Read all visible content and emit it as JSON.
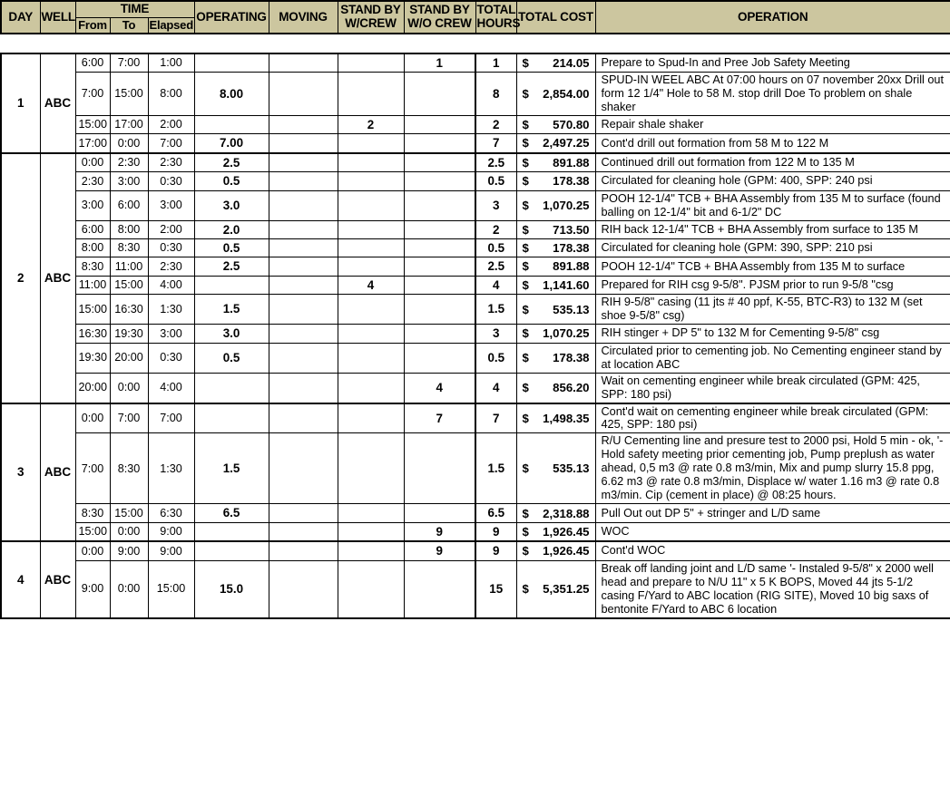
{
  "header": {
    "columns": {
      "day": "DAY",
      "well": "WELL",
      "time": "TIME",
      "from": "From",
      "to": "To",
      "elapsed": "Elapsed",
      "operating": "OPERATING",
      "moving": "MOVING",
      "standby_with_crew": "STAND BY W/CREW",
      "standby_with_crew_l1": "STAND BY",
      "standby_with_crew_l2": "W/CREW",
      "standby_without_crew_l1": "STAND BY",
      "standby_without_crew_l2": "W/O CREW",
      "total_hours_l1": "TOTAL",
      "total_hours_l2": "HOURS",
      "total_cost": "TOTAL COST",
      "operation": "OPERATION"
    }
  },
  "colors": {
    "header_bg": "#ccc69f",
    "grid": "#000000",
    "page_bg": "#ffffff"
  },
  "days": [
    {
      "day": "1",
      "well": "ABC",
      "rows": [
        {
          "from": "6:00",
          "to": "7:00",
          "elapsed": "1:00",
          "operating": "",
          "moving": "",
          "sb_with": "",
          "sb_without": "1",
          "total_hours": "1",
          "currency": "$",
          "cost": "214.05",
          "operation": "Prepare to Spud-In and Pree Job Safety Meeting"
        },
        {
          "from": "7:00",
          "to": "15:00",
          "elapsed": "8:00",
          "operating": "8.00",
          "moving": "",
          "sb_with": "",
          "sb_without": "",
          "total_hours": "8",
          "currency": "$",
          "cost": "2,854.00",
          "operation": "SPUD-IN WEEL ABC At 07:00 hours on 07 november 20xx Drill out form 12 1/4\" Hole to 58 M. stop drill Doe To problem on shale shaker"
        },
        {
          "from": "15:00",
          "to": "17:00",
          "elapsed": "2:00",
          "operating": "",
          "moving": "",
          "sb_with": "2",
          "sb_without": "",
          "total_hours": "2",
          "currency": "$",
          "cost": "570.80",
          "operation": "Repair shale shaker"
        },
        {
          "from": "17:00",
          "to": "0:00",
          "elapsed": "7:00",
          "operating": "7.00",
          "moving": "",
          "sb_with": "",
          "sb_without": "",
          "total_hours": "7",
          "currency": "$",
          "cost": "2,497.25",
          "operation": "Cont'd drill out formation from 58 M to 122 M"
        }
      ]
    },
    {
      "day": "2",
      "well": "ABC",
      "rows": [
        {
          "from": "0:00",
          "to": "2:30",
          "elapsed": "2:30",
          "operating": "2.5",
          "moving": "",
          "sb_with": "",
          "sb_without": "",
          "total_hours": "2.5",
          "currency": "$",
          "cost": "891.88",
          "operation": "Continued drill out formation from 122 M to 135 M"
        },
        {
          "from": "2:30",
          "to": "3:00",
          "elapsed": "0:30",
          "operating": "0.5",
          "moving": "",
          "sb_with": "",
          "sb_without": "",
          "total_hours": "0.5",
          "currency": "$",
          "cost": "178.38",
          "operation": "Circulated for cleaning hole (GPM: 400, SPP: 240 psi"
        },
        {
          "from": "3:00",
          "to": "6:00",
          "elapsed": "3:00",
          "operating": "3.0",
          "moving": "",
          "sb_with": "",
          "sb_without": "",
          "total_hours": "3",
          "currency": "$",
          "cost": "1,070.25",
          "operation": "POOH 12-1/4\" TCB + BHA Assembly from 135 M to surface  (found balling on 12-1/4\" bit and 6-1/2\" DC"
        },
        {
          "from": "6:00",
          "to": "8:00",
          "elapsed": "2:00",
          "operating": "2.0",
          "moving": "",
          "sb_with": "",
          "sb_without": "",
          "total_hours": "2",
          "currency": "$",
          "cost": "713.50",
          "operation": "RIH back 12-1/4\" TCB + BHA Assembly from surface to 135 M"
        },
        {
          "from": "8:00",
          "to": "8:30",
          "elapsed": "0:30",
          "operating": "0.5",
          "moving": "",
          "sb_with": "",
          "sb_without": "",
          "total_hours": "0.5",
          "currency": "$",
          "cost": "178.38",
          "operation": "Circulated for cleaning hole (GPM: 390, SPP: 210 psi"
        },
        {
          "from": "8:30",
          "to": "11:00",
          "elapsed": "2:30",
          "operating": "2.5",
          "moving": "",
          "sb_with": "",
          "sb_without": "",
          "total_hours": "2.5",
          "currency": "$",
          "cost": "891.88",
          "operation": "POOH 12-1/4\" TCB + BHA Assembly from 135 M to surface"
        },
        {
          "from": "11:00",
          "to": "15:00",
          "elapsed": "4:00",
          "operating": "",
          "moving": "",
          "sb_with": "4",
          "sb_without": "",
          "total_hours": "4",
          "currency": "$",
          "cost": "1,141.60",
          "operation": "Prepared for RIH csg 9-5/8\". PJSM prior to run 9-5/8 \"csg"
        },
        {
          "from": "15:00",
          "to": "16:30",
          "elapsed": "1:30",
          "operating": "1.5",
          "moving": "",
          "sb_with": "",
          "sb_without": "",
          "total_hours": "1.5",
          "currency": "$",
          "cost": "535.13",
          "operation": "RIH 9-5/8\" casing (11 jts # 40 ppf, K-55, BTC-R3) to 132 M (set shoe 9-5/8\" csg)"
        },
        {
          "from": "16:30",
          "to": "19:30",
          "elapsed": "3:00",
          "operating": "3.0",
          "moving": "",
          "sb_with": "",
          "sb_without": "",
          "total_hours": "3",
          "currency": "$",
          "cost": "1,070.25",
          "operation": "RIH stinger + DP 5\" to 132 M for Cementing 9-5/8\" csg"
        },
        {
          "from": "19:30",
          "to": "20:00",
          "elapsed": "0:30",
          "operating": "0.5",
          "moving": "",
          "sb_with": "",
          "sb_without": "",
          "total_hours": "0.5",
          "currency": "$",
          "cost": "178.38",
          "operation": "Circulated prior to cementing job. No Cementing engineer stand by at location ABC"
        },
        {
          "from": "20:00",
          "to": "0:00",
          "elapsed": "4:00",
          "operating": "",
          "moving": "",
          "sb_with": "",
          "sb_without": "4",
          "total_hours": "4",
          "currency": "$",
          "cost": "856.20",
          "operation": "Wait on cementing engineer while break circulated (GPM: 425, SPP: 180 psi)"
        }
      ]
    },
    {
      "day": "3",
      "well": "ABC",
      "rows": [
        {
          "from": "0:00",
          "to": "7:00",
          "elapsed": "7:00",
          "operating": "",
          "moving": "",
          "sb_with": "",
          "sb_without": "7",
          "total_hours": "7",
          "currency": "$",
          "cost": "1,498.35",
          "operation": "Cont'd wait on cementing engineer while break circulated (GPM: 425, SPP: 180 psi)"
        },
        {
          "from": "7:00",
          "to": "8:30",
          "elapsed": "1:30",
          "operating": "1.5",
          "moving": "",
          "sb_with": "",
          "sb_without": "",
          "total_hours": "1.5",
          "currency": "$",
          "cost": "535.13",
          "operation": "R/U Cementing line and presure test to 2000 psi, Hold 5 min - ok, '- Hold safety meeting prior cementing job, Pump preplush as water ahead, 0,5 m3 @ rate 0.8 m3/min, Mix and pump slurry 15.8 ppg, 6.62 m3 @ rate 0.8 m3/min, Displace w/ water 1.16 m3 @ rate 0.8 m3/min. Cip (cement in place) @ 08:25 hours."
        },
        {
          "from": "8:30",
          "to": "15:00",
          "elapsed": "6:30",
          "operating": "6.5",
          "moving": "",
          "sb_with": "",
          "sb_without": "",
          "total_hours": "6.5",
          "currency": "$",
          "cost": "2,318.88",
          "operation": "Pull Out out DP 5\" + stringer and L/D same"
        },
        {
          "from": "15:00",
          "to": "0:00",
          "elapsed": "9:00",
          "operating": "",
          "moving": "",
          "sb_with": "",
          "sb_without": "9",
          "total_hours": "9",
          "currency": "$",
          "cost": "1,926.45",
          "operation": "WOC"
        }
      ]
    },
    {
      "day": "4",
      "well": "ABC",
      "rows": [
        {
          "from": "0:00",
          "to": "9:00",
          "elapsed": "9:00",
          "operating": "",
          "moving": "",
          "sb_with": "",
          "sb_without": "9",
          "total_hours": "9",
          "currency": "$",
          "cost": "1,926.45",
          "operation": "Cont'd WOC"
        },
        {
          "from": "9:00",
          "to": "0:00",
          "elapsed": "15:00",
          "operating": "15.0",
          "moving": "",
          "sb_with": "",
          "sb_without": "",
          "total_hours": "15",
          "currency": "$",
          "cost": "5,351.25",
          "operation": "Break off landing joint and L/D same '- Instaled 9-5/8\" x 2000 well head and prepare to N/U 11\" x 5 K BOPS, Moved 44 jts 5-1/2 casing F/Yard to ABC location (RIG SITE), Moved 10 big saxs of bentonite F/Yard to ABC 6 location"
        }
      ]
    }
  ]
}
